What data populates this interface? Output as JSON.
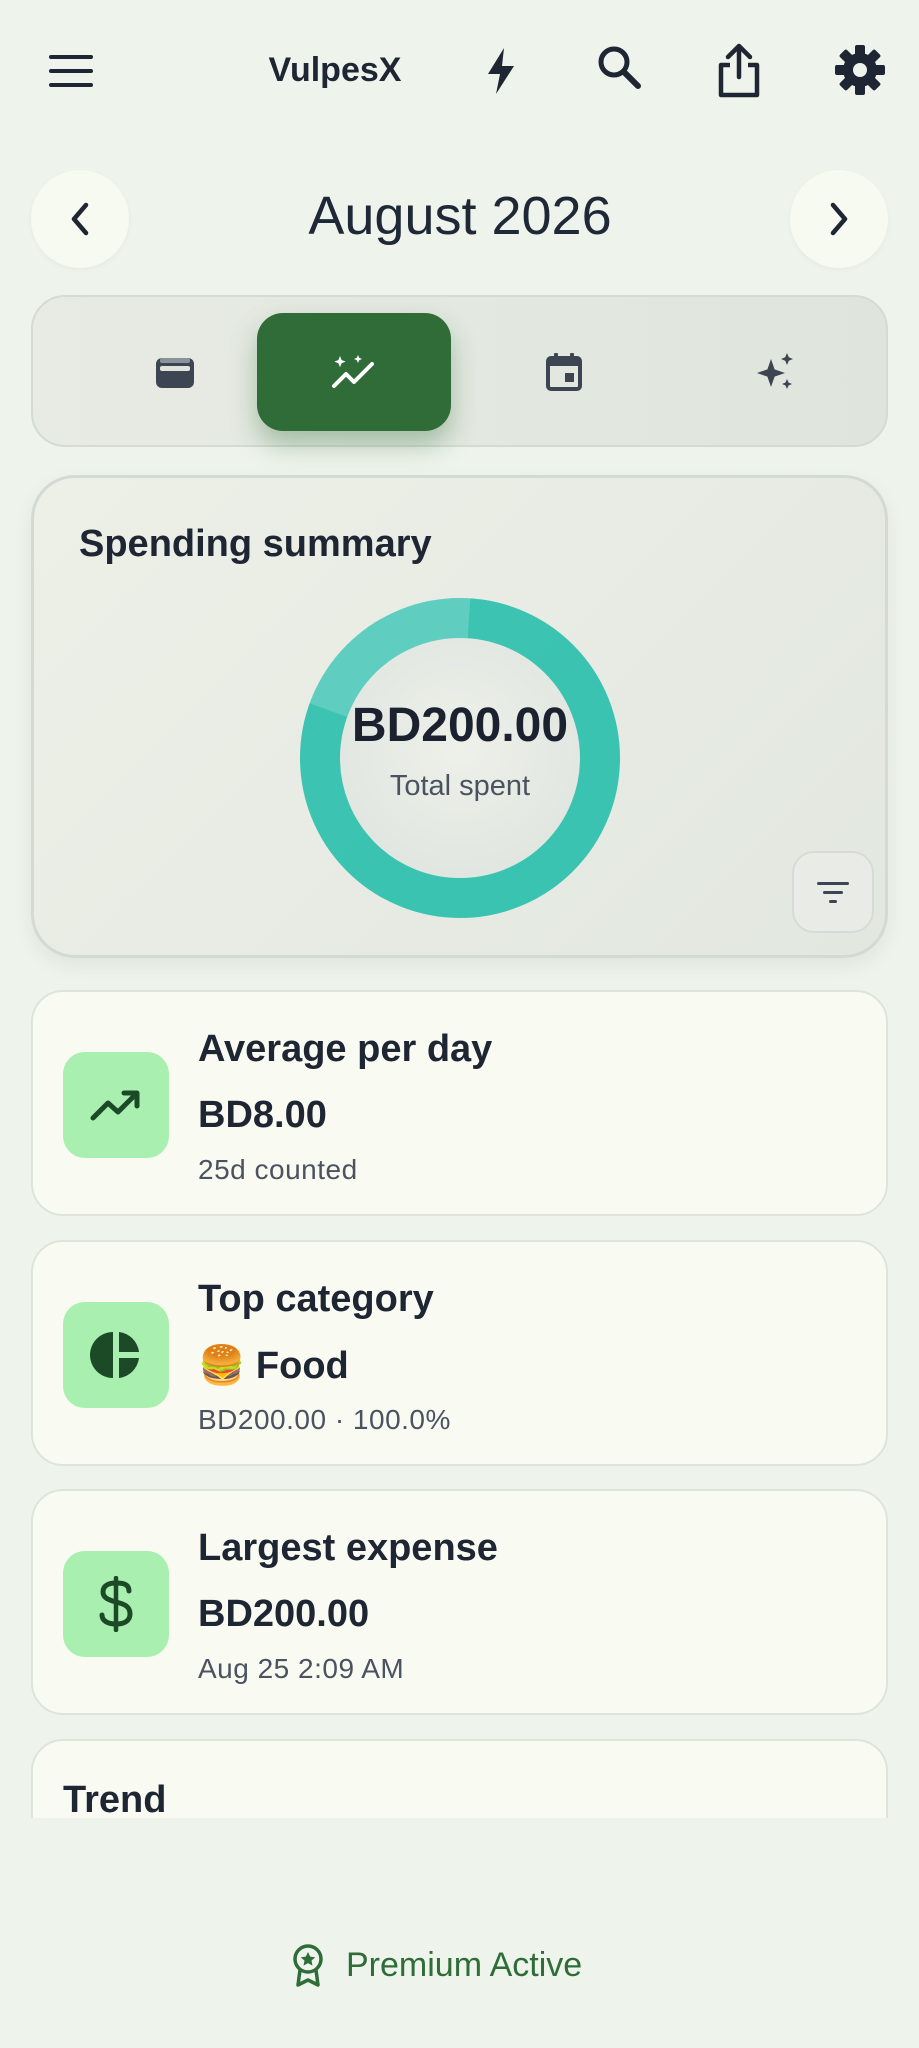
{
  "app": {
    "title": "VulpesX"
  },
  "topbar_icons": [
    "menu-icon",
    "lightning-icon",
    "search-icon",
    "share-icon",
    "gear-icon"
  ],
  "month_nav": {
    "label": "August 2026"
  },
  "tabs": [
    {
      "icon": "wallet-icon",
      "active": false
    },
    {
      "icon": "insights-chart-icon",
      "active": true
    },
    {
      "icon": "calendar-icon",
      "active": false
    },
    {
      "icon": "sparkle-icon",
      "active": false
    }
  ],
  "summary": {
    "title": "Spending summary",
    "total_value": "BD200.00",
    "total_caption": "Total spent"
  },
  "chart_data": {
    "type": "pie",
    "categories": [
      "Food"
    ],
    "values": [
      200.0
    ]
  },
  "stats": {
    "average": {
      "title": "Average per day",
      "value": "BD8.00",
      "sub": "25d counted"
    },
    "top_category": {
      "title": "Top category",
      "emoji": "🍔",
      "value": "Food",
      "sub": "BD200.00 · 100.0%"
    },
    "largest": {
      "title": "Largest expense",
      "value": "BD200.00",
      "sub": "Aug 25 2:09 AM"
    }
  },
  "trend": {
    "title": "Trend"
  },
  "premium": {
    "label": "Premium Active"
  },
  "colors": {
    "accent": "#2f6c37",
    "donut": "#2cbfae",
    "icon_bg": "#a8efb0",
    "background": "#eef4ec"
  }
}
